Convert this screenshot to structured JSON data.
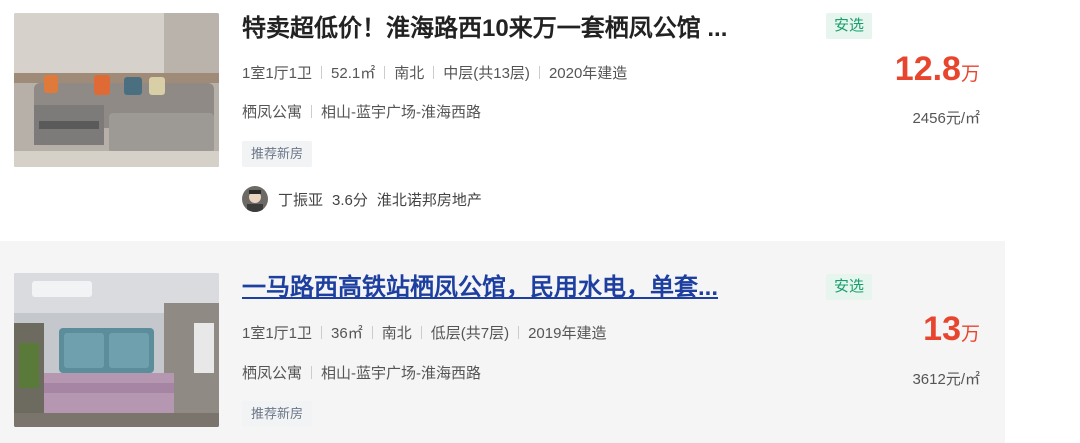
{
  "listings": [
    {
      "title": "特卖超低价！淮海路西10来万一套栖凤公馆 ...",
      "badge": "安选",
      "attributes": [
        "1室1厅1卫",
        "52.1㎡",
        "南北",
        "中层(共13层)",
        "2020年建造"
      ],
      "community": "栖凤公寓",
      "location": "相山-蓝宇广场-淮海西路",
      "tag": "推荐新房",
      "agent": {
        "name": "丁振亚",
        "score": "3.6分",
        "agency": "淮北诺邦房地产"
      },
      "price": {
        "value": "12.8",
        "unit": "万"
      },
      "unit_price": "2456元/㎡"
    },
    {
      "title": "一马路西高铁站栖凤公馆，民用水电，单套...",
      "badge": "安选",
      "attributes": [
        "1室1厅1卫",
        "36㎡",
        "南北",
        "低层(共7层)",
        "2019年建造"
      ],
      "community": "栖凤公寓",
      "location": "相山-蓝宇广场-淮海西路",
      "tag": "推荐新房",
      "price": {
        "value": "13",
        "unit": "万"
      },
      "unit_price": "3612元/㎡"
    }
  ],
  "colors": {
    "price": "#e8452f",
    "badge_bg": "#e6f6ef",
    "badge_text": "#1a9e6b",
    "visited_link": "#1d3fa0"
  }
}
